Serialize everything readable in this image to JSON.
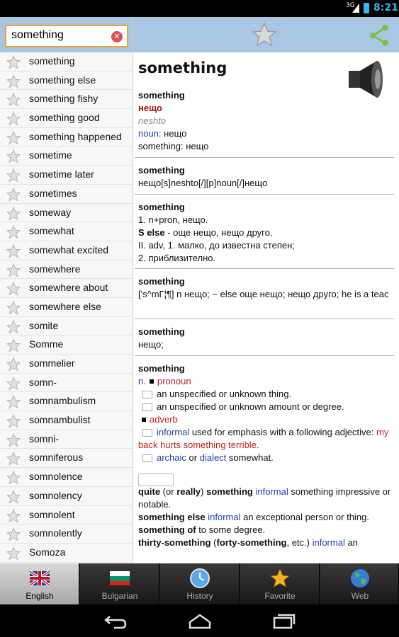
{
  "status": {
    "network": "3G",
    "time": "8:21"
  },
  "search": {
    "value": "something"
  },
  "words": [
    "something",
    "something else",
    "something fishy",
    "something good",
    "something happened",
    "sometime",
    "sometime later",
    "sometimes",
    "someway",
    "somewhat",
    "somewhat excited",
    "somewhere",
    "somewhere about",
    "somewhere else",
    "somite",
    "Somme",
    "sommelier",
    "somn-",
    "somnambulism",
    "somnambulist",
    "somni-",
    "somniferous",
    "somnolence",
    "somnolency",
    "somnolent",
    "somnolently",
    "Somoza"
  ],
  "article": {
    "title": "something",
    "e1": {
      "hw": "something",
      "tr": "нещо",
      "translit": "neshto",
      "pos": "noun:",
      "pos_tr": "нещо",
      "line2": "something: нещо"
    },
    "e2": {
      "hw": "something",
      "body": "нещо[s]neshto[/][p]noun[/]нещо"
    },
    "e3": {
      "hw": "something",
      "l1": "1. n+pron, нещо.",
      "l2_hw": "S else",
      "l2": " - още нещо, нещо друго.",
      "l3": "II. adv, 1. малко, до известна степен;",
      "l4": "2. приблизително."
    },
    "e4": {
      "hw": "something",
      "body": "['s^mГ¦¶] n нещо; ~ else още нещо; нещо друго; he is a teac"
    },
    "e5": {
      "hw": "something",
      "body": "нещо;"
    },
    "e6": {
      "hw": "something",
      "n_label": "n.",
      "pronoun": "pronoun",
      "p1": "an unspecified or unknown thing.",
      "p2": "an unspecified or unknown amount or degree.",
      "adverb": "adverb",
      "a1_blue": "informal",
      "a1": " used for emphasis with a following adjective: ",
      "a1_red": "my back hurts something terrible.",
      "a2_blue1": "archaic",
      "a2_or": " or ",
      "a2_blue2": "dialect",
      "a2": " somewhat."
    },
    "e7": {
      "q1_b1": "quite",
      "q1_t1": " (or ",
      "q1_b2": "really",
      "q1_t2": ") ",
      "q1_b3": "something",
      "q1_blue": " informal",
      "q1_t3": " something impressive or notable.",
      "q2_b": "something else",
      "q2_blue": " informal",
      "q2_t": " an exceptional person or thing.",
      "q3_b": "something of",
      "q3_t": " to some degree.",
      "q4_b1": "thirty-something",
      "q4_t1": " (",
      "q4_b2": "forty-something",
      "q4_t2": ", etc.) ",
      "q4_blue": "informal",
      "q4_t3": " an"
    }
  },
  "tabs": [
    {
      "label": "English",
      "icon": "uk-flag-icon"
    },
    {
      "label": "Bulgarian",
      "icon": "bulgaria-flag-icon"
    },
    {
      "label": "History",
      "icon": "clock-icon"
    },
    {
      "label": "Favorite",
      "icon": "star-icon"
    },
    {
      "label": "Web",
      "icon": "globe-icon"
    }
  ]
}
